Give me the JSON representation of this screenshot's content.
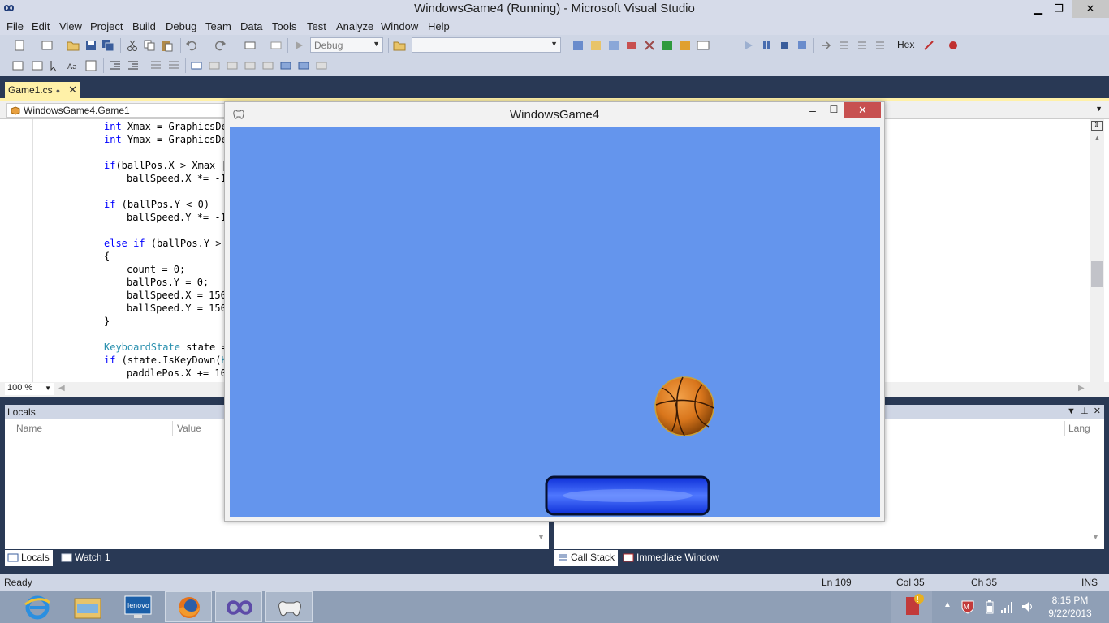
{
  "window": {
    "title": "WindowsGame4 (Running) - Microsoft Visual Studio",
    "min": "▁",
    "max": "❐",
    "close": "✕"
  },
  "menu": [
    "File",
    "Edit",
    "View",
    "Project",
    "Build",
    "Debug",
    "Team",
    "Data",
    "Tools",
    "Test",
    "Analyze",
    "Window",
    "Help"
  ],
  "toolbar": {
    "config": "Debug",
    "platform": "",
    "hex_label": "Hex"
  },
  "document": {
    "tab_label": "Game1.cs",
    "tab_close": "✕",
    "nav_class": "WindowsGame4.Game1"
  },
  "code_lines": [
    "    int Xmax = GraphicsDe",
    "    int Ymax = GraphicsDe",
    "",
    "    if(ballPos.X > Xmax |",
    "        ballSpeed.X *= -1",
    "",
    "    if (ballPos.Y < 0)",
    "        ballSpeed.Y *= -1",
    "",
    "    else if (ballPos.Y >",
    "    {",
    "        count = 0;",
    "        ballPos.Y = 0;",
    "        ballSpeed.X = 150",
    "        ballSpeed.Y = 150",
    "    }",
    "",
    "    KeyboardState state =",
    "    if (state.IsKeyDown(K",
    "        paddlePos.X += 10"
  ],
  "editor": {
    "zoom": "100 %"
  },
  "locals_pane": {
    "title": "Locals",
    "col_name": "Name",
    "col_value": "Value",
    "col_lang": "Lang"
  },
  "bottom_tabs_left": [
    "Locals",
    "Watch 1"
  ],
  "bottom_tabs_right": [
    "Call Stack",
    "Immediate Window"
  ],
  "status": {
    "state": "Ready",
    "line": "Ln 109",
    "col": "Col 35",
    "ch": "Ch 35",
    "mode": "INS"
  },
  "game_window": {
    "title": "WindowsGame4",
    "min": "–",
    "max": "☐",
    "close": "✕",
    "background": "#6495ed"
  },
  "taskbar": {
    "apps": [
      "internet-explorer",
      "file-explorer",
      "lenovo",
      "firefox",
      "visual-studio",
      "xna-game"
    ],
    "clock_time": "8:15 PM",
    "clock_date": "9/22/2013"
  }
}
